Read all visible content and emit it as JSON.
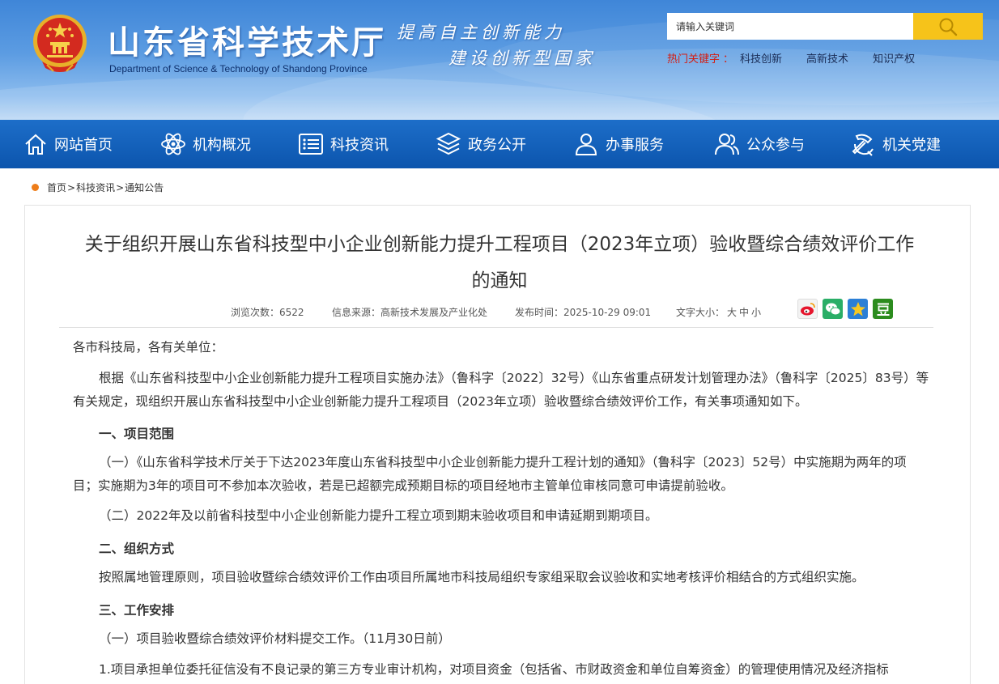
{
  "header": {
    "title": "山东省科学技术厅",
    "subtitle": "Department of Science & Technology of Shandong Province",
    "slogan_line1": "提高自主创新能力",
    "slogan_line2": "建设创新型国家",
    "search_placeholder": "请输入关键词",
    "hot_label": "热门关键字",
    "hot_colon": "：",
    "hot_words": [
      "科技创新",
      "高新技术",
      "知识产权"
    ]
  },
  "nav": {
    "items": [
      {
        "label": "网站首页",
        "icon": "home-icon"
      },
      {
        "label": "机构概况",
        "icon": "atom-icon"
      },
      {
        "label": "科技资讯",
        "icon": "list-icon"
      },
      {
        "label": "政务公开",
        "icon": "layers-icon"
      },
      {
        "label": "办事服务",
        "icon": "user-icon"
      },
      {
        "label": "公众参与",
        "icon": "group-icon"
      },
      {
        "label": "机关党建",
        "icon": "party-icon"
      }
    ]
  },
  "breadcrumb": {
    "items": [
      "首页",
      "科技资讯",
      "通知公告"
    ],
    "separator": ">"
  },
  "article": {
    "title_line1": "关于组织开展山东省科技型中小企业创新能力提升工程项目（2023年立项）验收暨综合绩效评价工作",
    "title_line2": "的通知",
    "meta": {
      "views_label": "浏览次数：",
      "views_value": "6522",
      "source_label": "信息来源：",
      "source_value": "高新技术发展及产业化处",
      "date_label": "发布时间：",
      "date_value": "2025-10-29 09:01",
      "font_label": "文字大小：",
      "font_large": "大",
      "font_medium": "中",
      "font_small": "小"
    },
    "share_icons": [
      "weibo-icon",
      "wechat-icon",
      "qzone-icon",
      "douban-icon"
    ],
    "greeting": "各市科技局，各有关单位：",
    "intro": "根据《山东省科技型中小企业创新能力提升工程项目实施办法》（鲁科字〔2022〕32号）《山东省重点研发计划管理办法》（鲁科字〔2025〕83号）等有关规定，现组织开展山东省科技型中小企业创新能力提升工程项目（2023年立项）验收暨综合绩效评价工作，有关事项通知如下。",
    "section1_heading": "一、项目范围",
    "section1_p1": "（一）《山东省科学技术厅关于下达2023年度山东省科技型中小企业创新能力提升工程计划的通知》（鲁科字〔2023〕52号）中实施期为两年的项目；实施期为3年的项目可不参加本次验收，若是已超额完成预期目标的项目经地市主管单位审核同意可申请提前验收。",
    "section1_p2": "（二）2022年及以前省科技型中小企业创新能力提升工程立项到期末验收项目和申请延期到期项目。",
    "section2_heading": "二、组织方式",
    "section2_p1": "按照属地管理原则，项目验收暨综合绩效评价工作由项目所属地市科技局组织专家组采取会议验收和实地考核评价相结合的方式组织实施。",
    "section3_heading": "三、工作安排",
    "section3_p1": "（一）项目验收暨综合绩效评价材料提交工作。（11月30日前）",
    "section3_p2": "1.项目承担单位委托征信没有不良记录的第三方专业审计机构，对项目资金（包括省、市财政资金和单位自筹资金）的管理使用情况及经济指标"
  },
  "colors": {
    "nav_bg": "#0c55ad",
    "search_button": "#f6c31a",
    "hot_label": "#d41d12",
    "breadcrumb_dot": "#ee7d1a"
  }
}
